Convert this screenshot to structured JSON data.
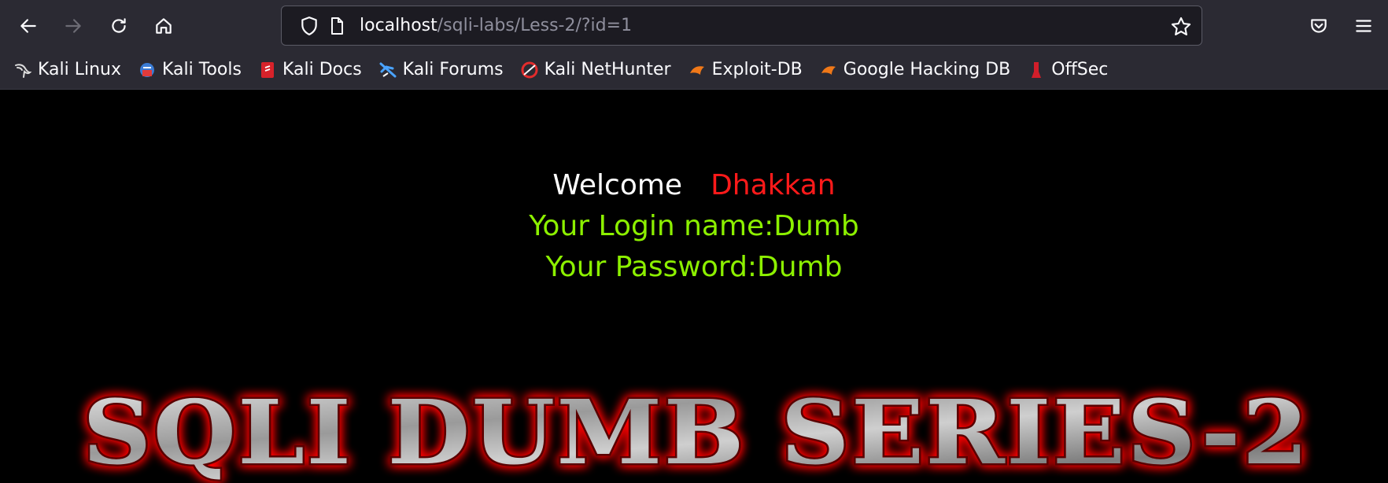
{
  "browser": {
    "url_host": "localhost",
    "url_path": "/sqli-labs/Less-2/?id=1",
    "icons": [
      "back-icon",
      "forward-icon",
      "reload-icon",
      "home-icon",
      "shield-icon",
      "page-icon",
      "star-icon",
      "pocket-icon",
      "menu-icon"
    ]
  },
  "bookmarks": [
    {
      "label": "Kali Linux",
      "icon": "kali-dragon-icon"
    },
    {
      "label": "Kali Tools",
      "icon": "kali-tools-icon"
    },
    {
      "label": "Kali Docs",
      "icon": "kali-docs-icon"
    },
    {
      "label": "Kali Forums",
      "icon": "kali-forums-icon"
    },
    {
      "label": "Kali NetHunter",
      "icon": "nethunter-icon"
    },
    {
      "label": "Exploit-DB",
      "icon": "exploit-db-icon"
    },
    {
      "label": "Google Hacking DB",
      "icon": "ghdb-icon"
    },
    {
      "label": "OffSec",
      "icon": "offsec-icon"
    }
  ],
  "page": {
    "welcome": "Welcome",
    "user": "Dhakkan",
    "login_name": "Your Login name:Dumb",
    "password": "Your Password:Dumb",
    "banner_title": "SQLI DUMB SERIES-2"
  },
  "colors": {
    "toolbar_bg": "#2b2a33",
    "page_bg": "#000000",
    "welcome_text": "#ffffff",
    "user_name": "#ff1a1a",
    "credentials_text": "#8cf000",
    "banner_glow": "#ff0000",
    "banner_fill": "#a9a9a9"
  }
}
